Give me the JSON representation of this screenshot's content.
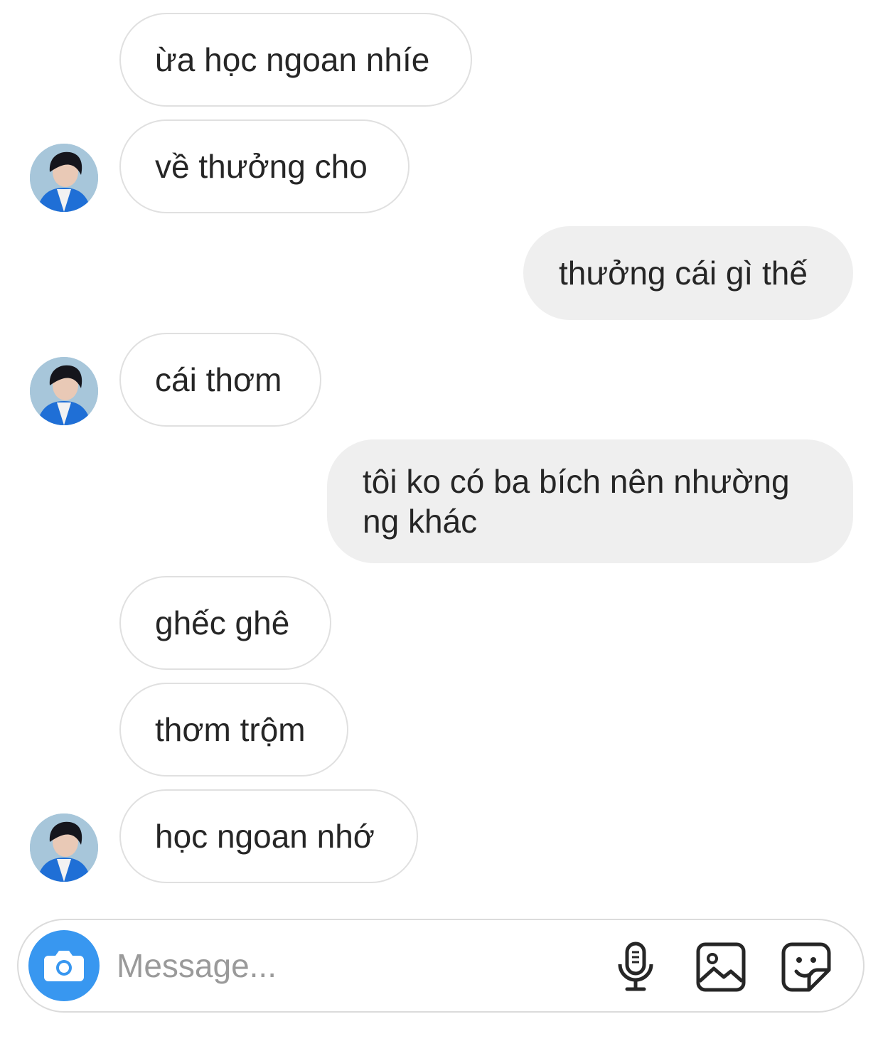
{
  "messages": [
    {
      "side": "in",
      "text": "ừa học ngoan nhíe",
      "avatar": false
    },
    {
      "side": "in",
      "text": "về thưởng cho",
      "avatar": true
    },
    {
      "side": "out",
      "text": "thưởng cái gì thế"
    },
    {
      "side": "in",
      "text": "cái thơm",
      "avatar": true
    },
    {
      "side": "out",
      "text": "tôi ko có ba bích nên nhường ng khác"
    },
    {
      "side": "in",
      "text": "ghếc ghê",
      "avatar": false
    },
    {
      "side": "in",
      "text": "thơm trộm",
      "avatar": false
    },
    {
      "side": "in",
      "text": "học ngoan nhớ",
      "avatar": true
    }
  ],
  "composer": {
    "placeholder": "Message...",
    "camera_icon": "camera-icon",
    "mic_icon": "microphone-icon",
    "gallery_icon": "image-gallery-icon",
    "sticker_icon": "sticker-icon"
  },
  "colors": {
    "accent": "#3897f0",
    "outgoing_bubble": "#efefef",
    "incoming_border": "#e0e0e0",
    "placeholder": "#9a9a9a"
  }
}
